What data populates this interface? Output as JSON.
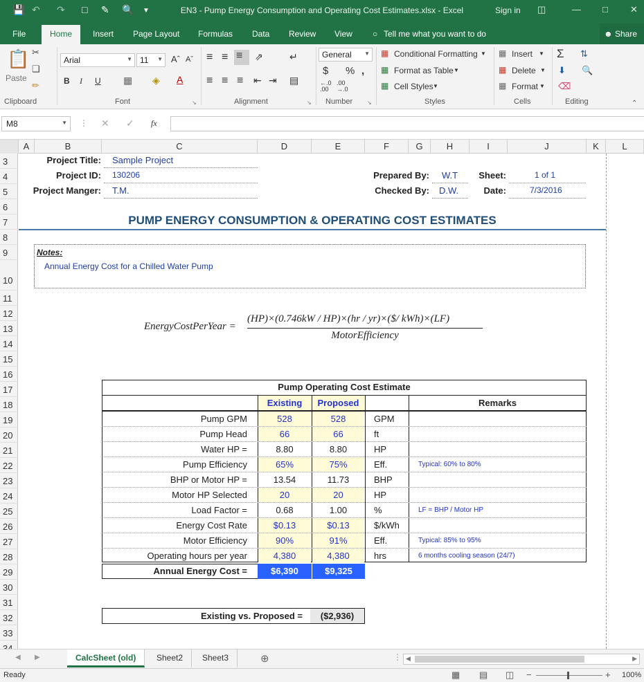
{
  "window": {
    "title": "EN3 - Pump Energy Consumption and Operating Cost Estimates.xlsx - Excel",
    "sign_in": "Sign in"
  },
  "ribbon_tabs": [
    "File",
    "Home",
    "Insert",
    "Page Layout",
    "Formulas",
    "Data",
    "Review",
    "View"
  ],
  "tell_me": "Tell me what you want to do",
  "share": "Share",
  "ribbon": {
    "paste": "Paste",
    "font_name": "Arial",
    "font_size": "11",
    "number_format": "General",
    "conditional_formatting": "Conditional Formatting",
    "format_as_table": "Format as Table",
    "cell_styles": "Cell Styles",
    "insert": "Insert",
    "delete": "Delete",
    "format": "Format",
    "groups": {
      "clipboard": "Clipboard",
      "font": "Font",
      "alignment": "Alignment",
      "number": "Number",
      "styles": "Styles",
      "cells": "Cells",
      "editing": "Editing"
    },
    "bold": "B",
    "italic": "I",
    "underline": "U",
    "currency": "$",
    "percent": "%",
    "comma": ","
  },
  "formula_bar": {
    "name_box": "M8",
    "formula": "",
    "fx": "fx"
  },
  "columns": [
    "A",
    "B",
    "C",
    "D",
    "E",
    "F",
    "G",
    "H",
    "I",
    "J",
    "K",
    "L"
  ],
  "rows": [
    "3",
    "4",
    "5",
    "6",
    "7",
    "8",
    "9",
    "10",
    "11",
    "12",
    "13",
    "14",
    "15",
    "16",
    "17",
    "18",
    "19",
    "20",
    "21",
    "22",
    "23",
    "24",
    "25",
    "26",
    "27",
    "28",
    "29",
    "30",
    "31",
    "32",
    "33",
    "34"
  ],
  "header": {
    "project_title_label": "Project Title:",
    "project_title": "Sample Project",
    "project_id_label": "Project ID:",
    "project_id": "130206",
    "project_manager_label": "Project Manger:",
    "project_manager": "T.M.",
    "prepared_by_label": "Prepared By:",
    "prepared_by": "W.T",
    "checked_by_label": "Checked By:",
    "checked_by": "D.W.",
    "sheet_label": "Sheet:",
    "sheet": "1 of  1",
    "date_label": "Date:",
    "date": "7/3/2016"
  },
  "sheet_title": "PUMP ENERGY CONSUMPTION & OPERATING COST ESTIMATES",
  "notes": {
    "label": "Notes:",
    "text": "Annual Energy Cost for a Chilled Water Pump"
  },
  "formula": {
    "lhs": "EnergyCostPerYear =",
    "numerator": "(HP)×(0.746kW / HP)×(hr / yr)×($/ kWh)×(LF)",
    "denominator": "MotorEfficiency"
  },
  "table": {
    "title": "Pump Operating Cost Estimate",
    "col_existing": "Existing",
    "col_proposed": "Proposed",
    "col_remarks": "Remarks",
    "rows": [
      {
        "label": "Pump GPM",
        "existing": "528",
        "proposed": "528",
        "unit": "GPM",
        "remark": "",
        "input": true
      },
      {
        "label": "Pump Head",
        "existing": "66",
        "proposed": "66",
        "unit": "ft",
        "remark": "",
        "input": true
      },
      {
        "label": "Water HP =",
        "existing": "8.80",
        "proposed": "8.80",
        "unit": "HP",
        "remark": "",
        "input": false
      },
      {
        "label": "Pump Efficiency",
        "existing": "65%",
        "proposed": "75%",
        "unit": "Eff.",
        "remark": "Typical: 60% to 80%",
        "input": true
      },
      {
        "label": "BHP or Motor HP =",
        "existing": "13.54",
        "proposed": "11.73",
        "unit": "BHP",
        "remark": "",
        "input": false
      },
      {
        "label": "Motor HP Selected",
        "existing": "20",
        "proposed": "20",
        "unit": "HP",
        "remark": "",
        "input": true
      },
      {
        "label": "Load Factor =",
        "existing": "0.68",
        "proposed": "1.00",
        "unit": "%",
        "remark": "LF = BHP / Motor HP",
        "input": false
      },
      {
        "label": "Energy Cost Rate",
        "existing": "$0.13",
        "proposed": "$0.13",
        "unit": "$/kWh",
        "remark": "",
        "input": true
      },
      {
        "label": "Motor Efficiency",
        "existing": "90%",
        "proposed": "91%",
        "unit": "Eff.",
        "remark": "Typical: 85% to 95%",
        "input": true
      },
      {
        "label": "Operating hours per year",
        "existing": "4,380",
        "proposed": "4,380",
        "unit": "hrs",
        "remark": "6 months cooling season (24/7)",
        "input": true
      }
    ],
    "total_label": "Annual Energy Cost =",
    "total_existing": "$6,390",
    "total_proposed": "$9,325"
  },
  "comparison": {
    "label": "Existing vs. Proposed =",
    "value": "($2,936)"
  },
  "sheet_tabs": [
    "CalcSheet (old)",
    "Sheet2",
    "Sheet3"
  ],
  "status": {
    "ready": "Ready",
    "zoom": "100%"
  },
  "colors": {
    "excel_green": "#217346",
    "title_blue": "#1f4e79",
    "input_fill": "#fffbd6",
    "total_fill": "#2962ff"
  }
}
